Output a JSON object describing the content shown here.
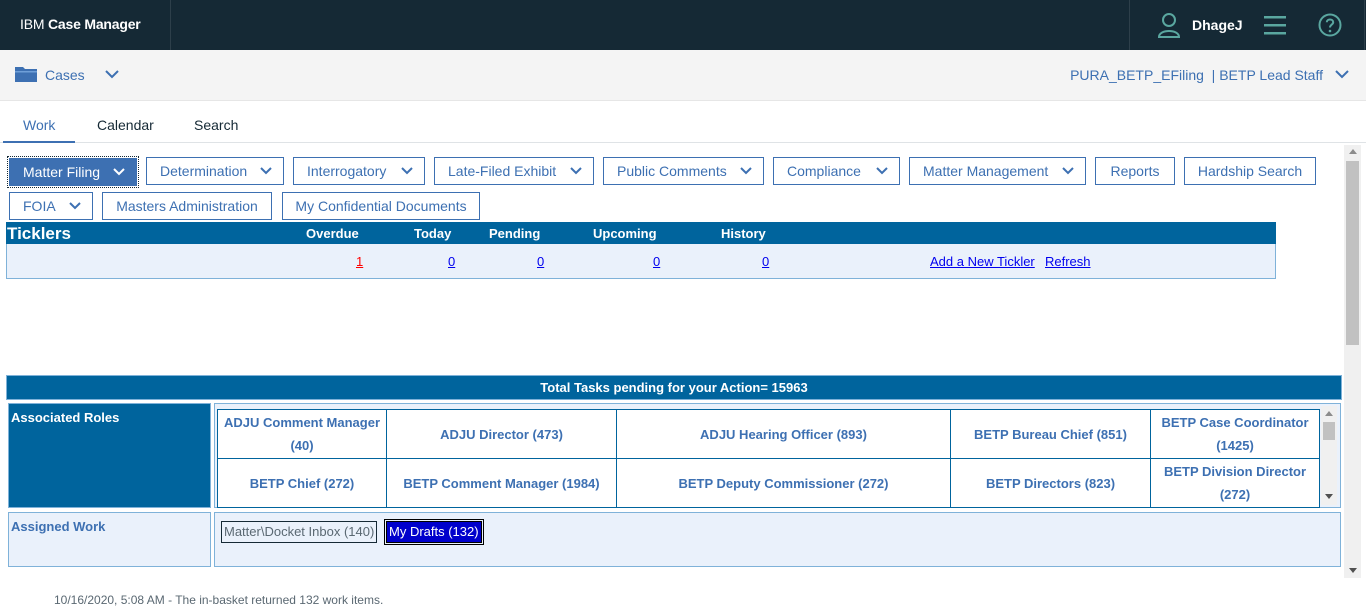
{
  "header": {
    "brand_prefix": "IBM",
    "brand_name": "Case Manager",
    "user_name": "DhageJ",
    "user_icon": "user-icon",
    "menu_icon": "hamburger-menu-icon",
    "help_icon": "help-icon"
  },
  "solution_bar": {
    "cases_label": "Cases",
    "solution_role": "PURA_BETP_EFiling  | BETP Lead Staff"
  },
  "tabs": [
    {
      "label": "Work",
      "selected": true
    },
    {
      "label": "Calendar",
      "selected": false
    },
    {
      "label": "Search",
      "selected": false
    }
  ],
  "nav_buttons": {
    "matter_filing": "Matter Filing",
    "determination": "Determination",
    "interrogatory": "Interrogatory",
    "late_filed_exhibit": "Late-Filed Exhibit",
    "public_comments": "Public Comments",
    "compliance": "Compliance",
    "matter_management": "Matter Management",
    "reports": "Reports",
    "hardship_search": "Hardship Search",
    "foia": "FOIA",
    "masters_administration": "Masters Administration",
    "my_confidential_documents": "My Confidential Documents"
  },
  "ticklers": {
    "title": "Ticklers",
    "columns": {
      "overdue": "Overdue",
      "today": "Today",
      "pending": "Pending",
      "upcoming": "Upcoming",
      "history": "History"
    },
    "values": {
      "overdue": "1",
      "today": "0",
      "pending": "0",
      "upcoming": "0",
      "history": "0"
    },
    "add_link": "Add a New Tickler",
    "refresh_link": "Refresh"
  },
  "tasks": {
    "total_label": "Total Tasks pending for your Action= 15963",
    "associated_roles_label": "Associated Roles",
    "roles": [
      "ADJU Comment Manager (40)",
      "ADJU Director (473)",
      "ADJU Hearing Officer (893)",
      "BETP Bureau Chief (851)",
      "BETP Case Coordinator (1425)",
      "BETP Chief (272)",
      "BETP Comment Manager (1984)",
      "BETP Deputy Commissioner (272)",
      "BETP Directors (823)",
      "BETP Division Director (272)"
    ],
    "assigned_work_label": "Assigned Work",
    "inboxes": [
      "Matter\\Docket Inbox (140)",
      "My Drafts (132)"
    ]
  },
  "status": "10/16/2020, 5:08 AM - The in-basket returned 132 work items.",
  "colors": {
    "header_bg": "#152935",
    "accent": "#3d70b2",
    "table_blue": "#00649d",
    "overdue_red": "#ff0000"
  }
}
